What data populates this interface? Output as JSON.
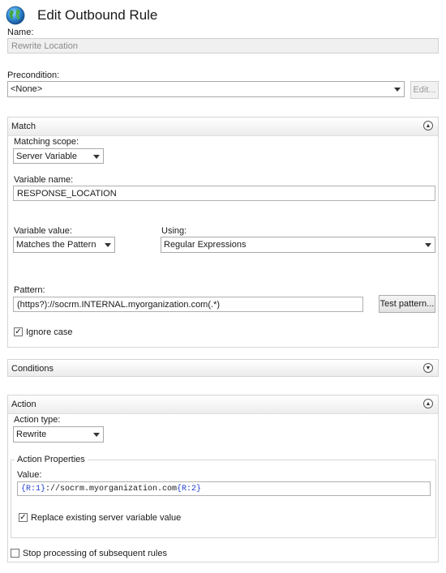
{
  "header": {
    "title": "Edit Outbound Rule"
  },
  "name": {
    "label": "Name:",
    "value": "Rewrite Location"
  },
  "precondition": {
    "label": "Precondition:",
    "value": "<None>",
    "edit_label": "Edit..."
  },
  "match": {
    "title": "Match",
    "scope_label": "Matching scope:",
    "scope_value": "Server Variable",
    "varname_label": "Variable name:",
    "varname_value": "RESPONSE_LOCATION",
    "varvalue_label": "Variable value:",
    "varvalue_value": "Matches the Pattern",
    "using_label": "Using:",
    "using_value": "Regular Expressions",
    "pattern_label": "Pattern:",
    "pattern_value": "(https?)://socrm.INTERNAL.myorganization.com(.*)",
    "test_label": "Test pattern...",
    "ignore_case_label": "Ignore case",
    "ignore_case_checked": true
  },
  "conditions": {
    "title": "Conditions"
  },
  "action": {
    "title": "Action",
    "type_label": "Action type:",
    "type_value": "Rewrite",
    "props_label": "Action Properties",
    "value_label": "Value:",
    "value_parts": [
      "{R:1}",
      "://socrm.myorganization.com",
      "{R:2}"
    ],
    "replace_label": "Replace existing server variable value",
    "replace_checked": true
  },
  "stop": {
    "label": "Stop processing of subsequent rules",
    "checked": false
  }
}
